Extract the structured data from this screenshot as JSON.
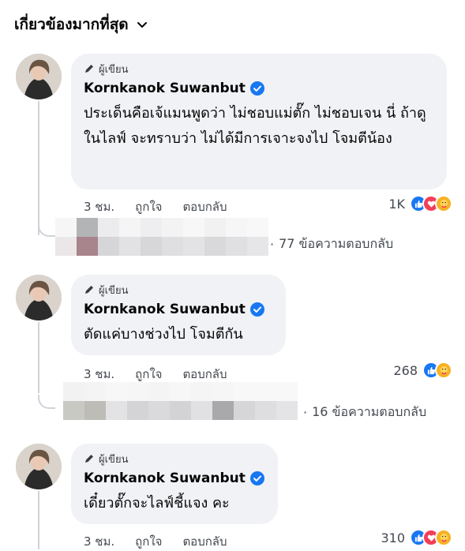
{
  "header": {
    "sort_label": "เกี่ยวข้องมากที่สุด"
  },
  "colors": {
    "verified_blue": "#1877f2",
    "like_blue": "#1877f2",
    "love_red": "#f33e58",
    "care_yellow": "#f7b125",
    "bubble_bg": "#f0f2f5"
  },
  "comments": [
    {
      "author_badge": "ผู้เขียน",
      "author": "Kornkanok Suwanbut",
      "text": "ประเด็นคือเจ้แมนพูดว่า ไม่ชอบแม่ตั๊ก ไม่ชอบเจน นี่ ถ้าดูในไลฟ์ จะทราบว่า ไม่ได้มีการเจาะจงไป โจมตีน้อง",
      "time": "3 ชม.",
      "like_label": "ถูกใจ",
      "reply_label": "ตอบกลับ",
      "reaction_count": "1K",
      "reaction_icons": [
        "like-icon",
        "love-icon",
        "care-icon"
      ],
      "replies_label": "77 ข้อความตอบกลับ"
    },
    {
      "author_badge": "ผู้เขียน",
      "author": "Kornkanok Suwanbut",
      "text": "ตัดแค่บางช่วงไป โจมตีกัน",
      "time": "3 ชม.",
      "like_label": "ถูกใจ",
      "reply_label": "ตอบกลับ",
      "reaction_count": "268",
      "reaction_icons": [
        "like-icon",
        "care-icon"
      ],
      "replies_label": "16 ข้อความตอบกลับ"
    },
    {
      "author_badge": "ผู้เขียน",
      "author": "Kornkanok Suwanbut",
      "text": "เดี๋ยวตั๊กจะไลฟ์ชี้แจง คะ",
      "time": "3 ชม.",
      "like_label": "ถูกใจ",
      "reply_label": "ตอบกลับ",
      "reaction_count": "310",
      "reaction_icons": [
        "like-icon",
        "love-icon",
        "care-icon"
      ]
    }
  ]
}
